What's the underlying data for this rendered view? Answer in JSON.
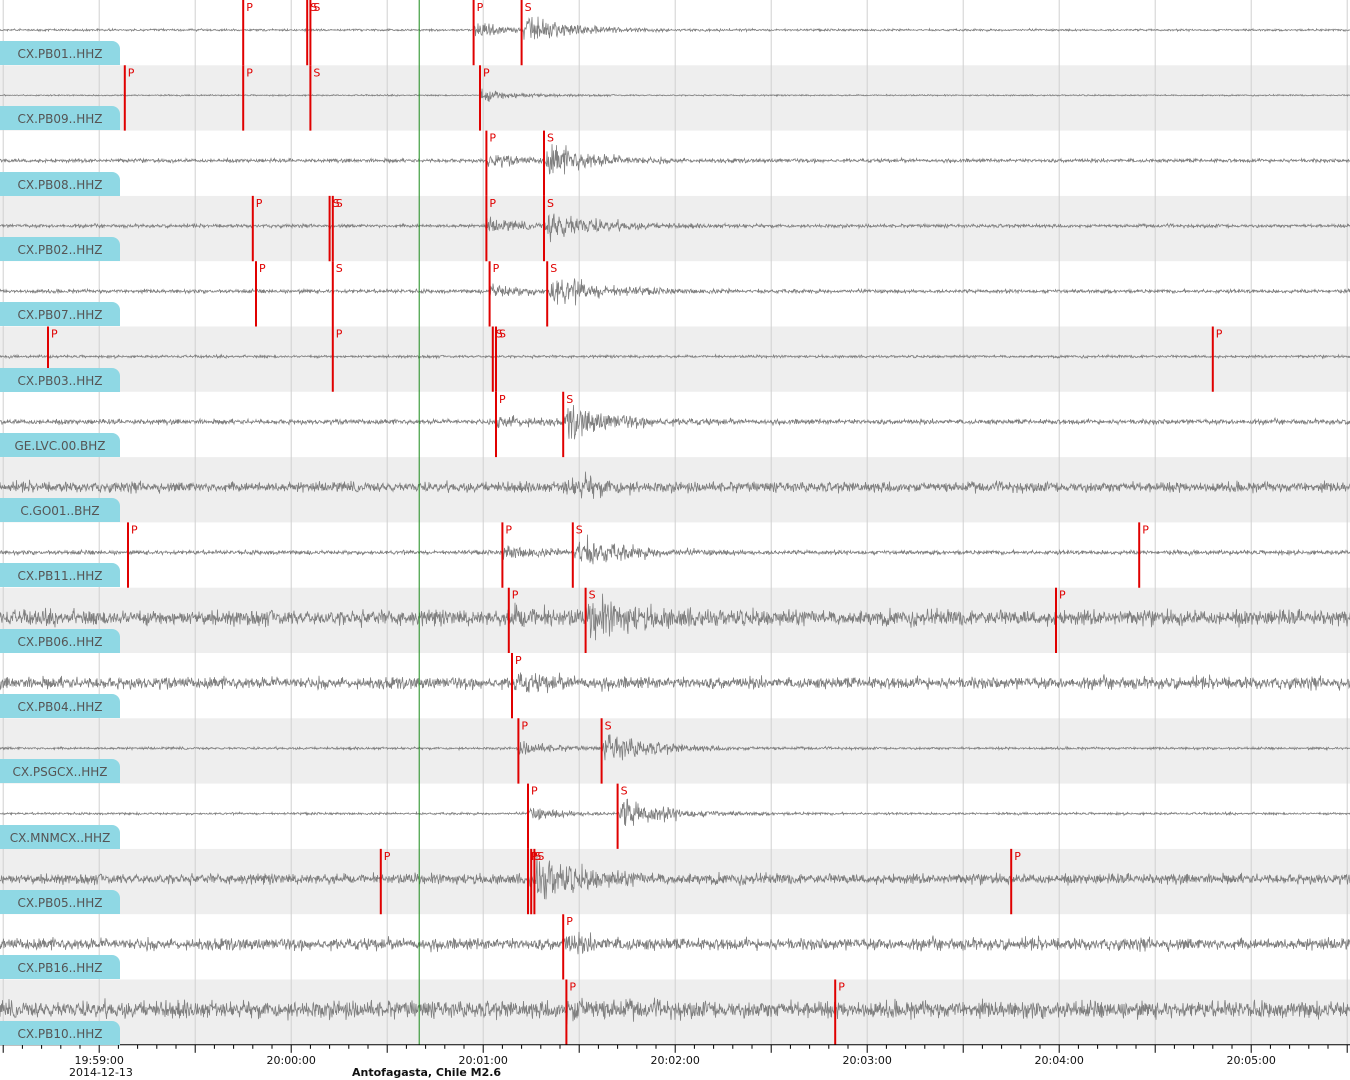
{
  "event": {
    "title": "Antofagasta, Chile M2.6"
  },
  "time_axis": {
    "date": "2014-12-13",
    "ticks": [
      "19:59:00",
      "20:00:00",
      "20:01:00",
      "20:02:00",
      "20:03:00",
      "20:04:00",
      "20:05:00"
    ]
  },
  "colors": {
    "trace": "#808080",
    "pick": "#e00000",
    "origin_line": "#1a8a1a",
    "label_bg": "#8fd8e4",
    "alt_band": "#eeeeee",
    "grid": "#d0d0d0"
  },
  "tracks": [
    {
      "label": "CX.PB01..HHZ",
      "picks": [
        {
          "t": "19:59:45",
          "p": "P"
        },
        {
          "t": "20:00:05",
          "p": "S"
        },
        {
          "t": "20:00:06",
          "p": "S"
        },
        {
          "t": "20:00:57",
          "p": "P"
        },
        {
          "t": "20:01:12",
          "p": "S"
        }
      ]
    },
    {
      "label": "CX.PB09..HHZ",
      "picks": [
        {
          "t": "19:59:08",
          "p": "P"
        },
        {
          "t": "19:59:45",
          "p": "P"
        },
        {
          "t": "20:00:06",
          "p": "S"
        },
        {
          "t": "20:00:59",
          "p": "P"
        }
      ]
    },
    {
      "label": "CX.PB08..HHZ",
      "picks": [
        {
          "t": "20:01:01",
          "p": "P"
        },
        {
          "t": "20:01:19",
          "p": "S"
        }
      ]
    },
    {
      "label": "CX.PB02..HHZ",
      "picks": [
        {
          "t": "19:59:48",
          "p": "P"
        },
        {
          "t": "20:00:12",
          "p": "S"
        },
        {
          "t": "20:00:13",
          "p": "S"
        },
        {
          "t": "20:01:01",
          "p": "P"
        },
        {
          "t": "20:01:19",
          "p": "S"
        }
      ]
    },
    {
      "label": "CX.PB07..HHZ",
      "picks": [
        {
          "t": "19:59:49",
          "p": "P"
        },
        {
          "t": "20:00:13",
          "p": "S"
        },
        {
          "t": "20:01:02",
          "p": "P"
        },
        {
          "t": "20:01:20",
          "p": "S"
        }
      ]
    },
    {
      "label": "CX.PB03..HHZ",
      "picks": [
        {
          "t": "19:58:44",
          "p": "P"
        },
        {
          "t": "20:00:13",
          "p": "P"
        },
        {
          "t": "20:01:03",
          "p": "S"
        },
        {
          "t": "20:01:04",
          "p": "S"
        },
        {
          "t": "20:04:48",
          "p": "P"
        }
      ]
    },
    {
      "label": "GE.LVC.00.BHZ",
      "picks": [
        {
          "t": "20:01:04",
          "p": "P"
        },
        {
          "t": "20:01:25",
          "p": "S"
        }
      ]
    },
    {
      "label": "C.GO01..BHZ",
      "picks": []
    },
    {
      "label": "CX.PB11..HHZ",
      "picks": [
        {
          "t": "19:59:09",
          "p": "P"
        },
        {
          "t": "20:01:06",
          "p": "P"
        },
        {
          "t": "20:01:28",
          "p": "S"
        },
        {
          "t": "20:04:25",
          "p": "P"
        }
      ]
    },
    {
      "label": "CX.PB06..HHZ",
      "picks": [
        {
          "t": "20:01:08",
          "p": "P"
        },
        {
          "t": "20:01:32",
          "p": "S"
        },
        {
          "t": "20:03:59",
          "p": "P"
        }
      ]
    },
    {
      "label": "CX.PB04..HHZ",
      "picks": [
        {
          "t": "20:01:09",
          "p": "P"
        }
      ]
    },
    {
      "label": "CX.PSGCX..HHZ",
      "picks": [
        {
          "t": "20:01:11",
          "p": "P"
        },
        {
          "t": "20:01:37",
          "p": "S"
        }
      ]
    },
    {
      "label": "CX.MNMCX..HHZ",
      "picks": [
        {
          "t": "20:01:14",
          "p": "P"
        },
        {
          "t": "20:01:42",
          "p": "S"
        }
      ]
    },
    {
      "label": "CX.PB05..HHZ",
      "picks": [
        {
          "t": "20:00:28",
          "p": "P"
        },
        {
          "t": "20:01:14",
          "p": "P"
        },
        {
          "t": "20:01:15",
          "p": "S"
        },
        {
          "t": "20:01:16",
          "p": "S"
        },
        {
          "t": "20:03:45",
          "p": "P"
        }
      ]
    },
    {
      "label": "CX.PB16..HHZ",
      "picks": [
        {
          "t": "20:01:25",
          "p": "P"
        }
      ]
    },
    {
      "label": "CX.PB10..HHZ",
      "picks": [
        {
          "t": "20:01:26",
          "p": "P"
        },
        {
          "t": "20:02:50",
          "p": "P"
        }
      ]
    }
  ]
}
